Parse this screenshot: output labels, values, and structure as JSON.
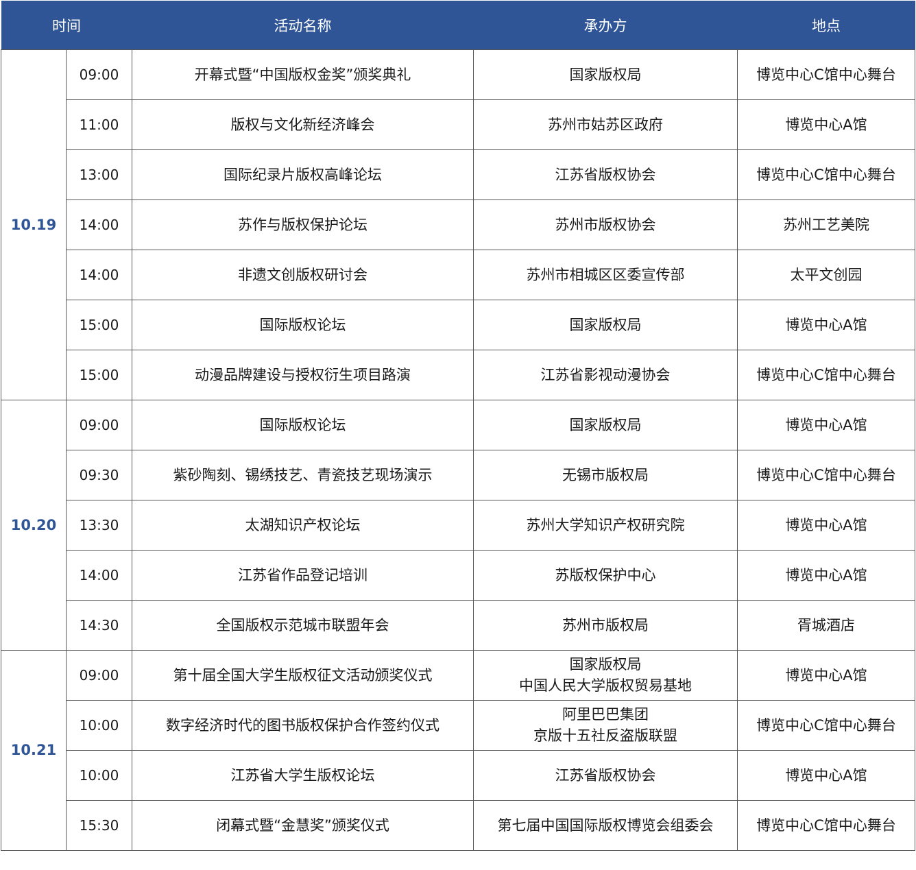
{
  "header": {
    "time": "时间",
    "name": "活动名称",
    "organizer": "承办方",
    "venue": "地点"
  },
  "days": [
    {
      "date": "10.19",
      "rows": [
        {
          "time": "09:00",
          "name": "开幕式暨“中国版权金奖”颁奖典礼",
          "organizer": [
            "国家版权局"
          ],
          "venue": "博览中心C馆中心舞台"
        },
        {
          "time": "11:00",
          "name": "版权与文化新经济峰会",
          "organizer": [
            "苏州市姑苏区政府"
          ],
          "venue": "博览中心A馆"
        },
        {
          "time": "13:00",
          "name": "国际纪录片版权高峰论坛",
          "organizer": [
            "江苏省版权协会"
          ],
          "venue": "博览中心C馆中心舞台"
        },
        {
          "time": "14:00",
          "name": "苏作与版权保护论坛",
          "organizer": [
            "苏州市版权协会"
          ],
          "venue": "苏州工艺美院"
        },
        {
          "time": "14:00",
          "name": "非遗文创版权研讨会",
          "organizer": [
            "苏州市相城区区委宣传部"
          ],
          "venue": "太平文创园"
        },
        {
          "time": "15:00",
          "name": "国际版权论坛",
          "organizer": [
            "国家版权局"
          ],
          "venue": "博览中心A馆"
        },
        {
          "time": "15:00",
          "name": "动漫品牌建设与授权衍生项目路演",
          "organizer": [
            "江苏省影视动漫协会"
          ],
          "venue": "博览中心C馆中心舞台"
        }
      ]
    },
    {
      "date": "10.20",
      "rows": [
        {
          "time": "09:00",
          "name": "国际版权论坛",
          "organizer": [
            "国家版权局"
          ],
          "venue": "博览中心A馆"
        },
        {
          "time": "09:30",
          "name": "紫砂陶刻、锡绣技艺、青瓷技艺现场演示",
          "organizer": [
            "无锡市版权局"
          ],
          "venue": "博览中心C馆中心舞台"
        },
        {
          "time": "13:30",
          "name": "太湖知识产权论坛",
          "organizer": [
            "苏州大学知识产权研究院"
          ],
          "venue": "博览中心A馆"
        },
        {
          "time": "14:00",
          "name": "江苏省作品登记培训",
          "organizer": [
            "苏版权保护中心"
          ],
          "venue": "博览中心A馆"
        },
        {
          "time": "14:30",
          "name": "全国版权示范城市联盟年会",
          "organizer": [
            "苏州市版权局"
          ],
          "venue": "胥城酒店"
        }
      ]
    },
    {
      "date": "10.21",
      "rows": [
        {
          "time": "09:00",
          "name": "第十届全国大学生版权征文活动颁奖仪式",
          "organizer": [
            "国家版权局",
            "中国人民大学版权贸易基地"
          ],
          "venue": "博览中心A馆"
        },
        {
          "time": "10:00",
          "name": "数字经济时代的图书版权保护合作签约仪式",
          "organizer": [
            "阿里巴巴集团",
            "京版十五社反盗版联盟"
          ],
          "venue": "博览中心C馆中心舞台"
        },
        {
          "time": "10:00",
          "name": "江苏省大学生版权论坛",
          "organizer": [
            "江苏省版权协会"
          ],
          "venue": "博览中心A馆"
        },
        {
          "time": "15:30",
          "name": "闭幕式暨“金慧奖”颁奖仪式",
          "organizer": [
            "第七届中国国际版权博览会组委会"
          ],
          "venue": "博览中心C馆中心舞台"
        }
      ]
    }
  ]
}
